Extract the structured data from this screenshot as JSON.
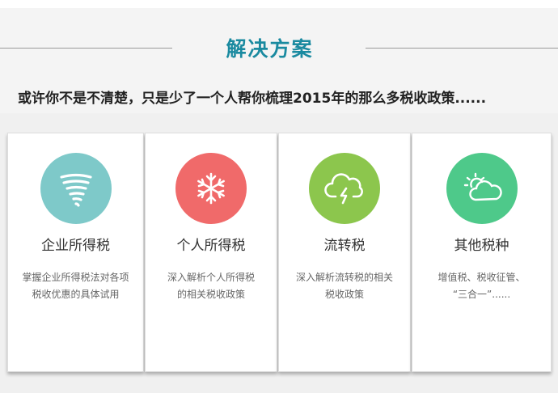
{
  "section": {
    "title": "解决方案",
    "subtitle": "或许你不是不清楚，只是少了一个人帮你梳理2015年的那么多税收政策......"
  },
  "cards": [
    {
      "title": "企业所得税",
      "desc_line1": "掌握企业所得税法对各项",
      "desc_line2": "税收优惠的具体试用",
      "icon": "tornado-icon",
      "color": "#7ec9c9"
    },
    {
      "title": "个人所得税",
      "desc_line1": "深入解析个人所得税",
      "desc_line2": "的相关税收政策",
      "icon": "snowflake-icon",
      "color": "#f06a6a"
    },
    {
      "title": "流转税",
      "desc_line1": "深入解析流转税的相关",
      "desc_line2": "税收政策",
      "icon": "thunderstorm-icon",
      "color": "#8cc64d"
    },
    {
      "title": "其他税种",
      "desc_line1": "增值税、税收征管、",
      "desc_line2": "“三合一”......",
      "icon": "partly-cloudy-icon",
      "color": "#4ec98a"
    }
  ]
}
